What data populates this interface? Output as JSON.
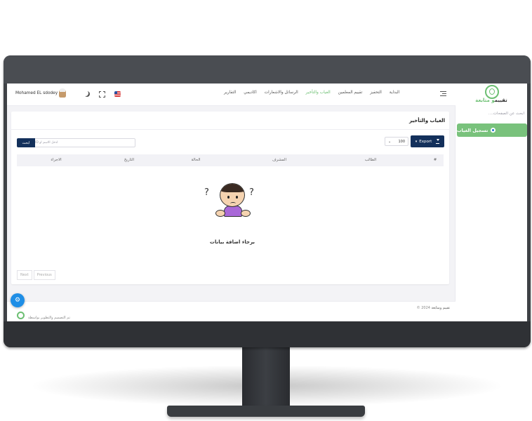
{
  "user": {
    "name": "Mohamed EL sdodey"
  },
  "logo": {
    "part1": "تقييم",
    "part2": "متابعة",
    "joiner": "و"
  },
  "sidebar": {
    "search_placeholder": "ابحث عن الصفحات....",
    "items": [
      {
        "label": "تسجيل الغياب",
        "active": true
      }
    ]
  },
  "nav": {
    "links": [
      "البداية",
      "التحفيز",
      "تقييم المعلمين",
      "الغياب والتأخير",
      "الرسائل والاشعارات",
      "اكاديمي",
      "التقارير"
    ],
    "active_index": 3
  },
  "page": {
    "title": "الغياب والتأخير"
  },
  "toolbar": {
    "export_label": "Export",
    "per_page_value": "100",
    "search_placeholder": "ادخل الاسم او ID",
    "search_button": "ابحث"
  },
  "table": {
    "columns": [
      "#",
      "الطالب",
      "المشرف",
      "الحالة",
      "التاريخ",
      "الاجراء"
    ]
  },
  "empty_state": {
    "message": "برجاء اضافة بيانات"
  },
  "pagination": {
    "next": "Next",
    "previous": "Previous"
  },
  "footer": {
    "copyright": "2024 ©",
    "brand": "تقييم ومتابعة",
    "credit": "تم التصميم والتطوير بواسطة"
  },
  "colors": {
    "accent_green": "#6cbf72",
    "primary_navy": "#13305b",
    "fab_blue": "#1e8ee6"
  }
}
